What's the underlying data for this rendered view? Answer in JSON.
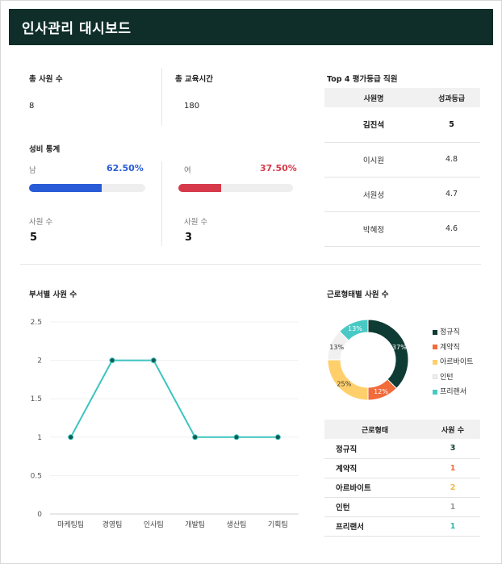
{
  "header": {
    "title": "인사관리 대시보드"
  },
  "summary": {
    "employees_label": "총 사원 수",
    "employees_value": "8",
    "training_label": "총 교육시간",
    "training_value": "180"
  },
  "gender": {
    "title": "성비 통계",
    "count_label": "사원 수",
    "male": {
      "label": "남",
      "percent_text": "62.50%",
      "fraction": 0.625,
      "count": "5",
      "color": "#2a5bd7"
    },
    "female": {
      "label": "여",
      "percent_text": "37.50%",
      "fraction": 0.375,
      "count": "3",
      "color": "#d63a4a"
    }
  },
  "top4": {
    "title": "Top 4 평가등급 직원",
    "headers": [
      "사원명",
      "성과등급"
    ],
    "rows": [
      {
        "name": "김진석",
        "grade": "5"
      },
      {
        "name": "이시원",
        "grade": "4.8"
      },
      {
        "name": "서원성",
        "grade": "4.7"
      },
      {
        "name": "박혜정",
        "grade": "4.6"
      }
    ]
  },
  "dept_chart": {
    "title": "부서별 사원 수",
    "chart_data": {
      "type": "line",
      "categories": [
        "마케팅팀",
        "경영팀",
        "인사팀",
        "개발팀",
        "생산팀",
        "기획팀"
      ],
      "values": [
        1,
        2,
        2,
        1,
        1,
        1
      ],
      "ylim": [
        0,
        2.5
      ],
      "yticks": [
        "0",
        "0.5",
        "1",
        "1.5",
        "2",
        "2.5"
      ],
      "line_color": "#3cc4bf",
      "point_color": "#0f5b52"
    }
  },
  "employment": {
    "title": "근로형태별 사원 수",
    "chart_data": {
      "type": "pie",
      "labels": [
        "정규직",
        "계약직",
        "아르바이트",
        "인턴",
        "프리랜서"
      ],
      "values": [
        3,
        1,
        2,
        1,
        1
      ],
      "percent_labels": [
        "37%",
        "12%",
        "25%",
        "13%",
        "13%"
      ],
      "colors": [
        "#0f3b35",
        "#f26b3a",
        "#ffcf6b",
        "#f0f0f0",
        "#49c9c5"
      ]
    },
    "table": {
      "headers": [
        "근로형태",
        "사원 수"
      ],
      "rows": [
        {
          "name": "정규직",
          "count": "3",
          "color": "#0f3b35"
        },
        {
          "name": "계약직",
          "count": "1",
          "color": "#f26b3a"
        },
        {
          "name": "아르바이트",
          "count": "2",
          "color": "#f5b944"
        },
        {
          "name": "인턴",
          "count": "1",
          "color": "#9a9a9a"
        },
        {
          "name": "프리랜서",
          "count": "1",
          "color": "#2fb8b3"
        }
      ]
    }
  }
}
